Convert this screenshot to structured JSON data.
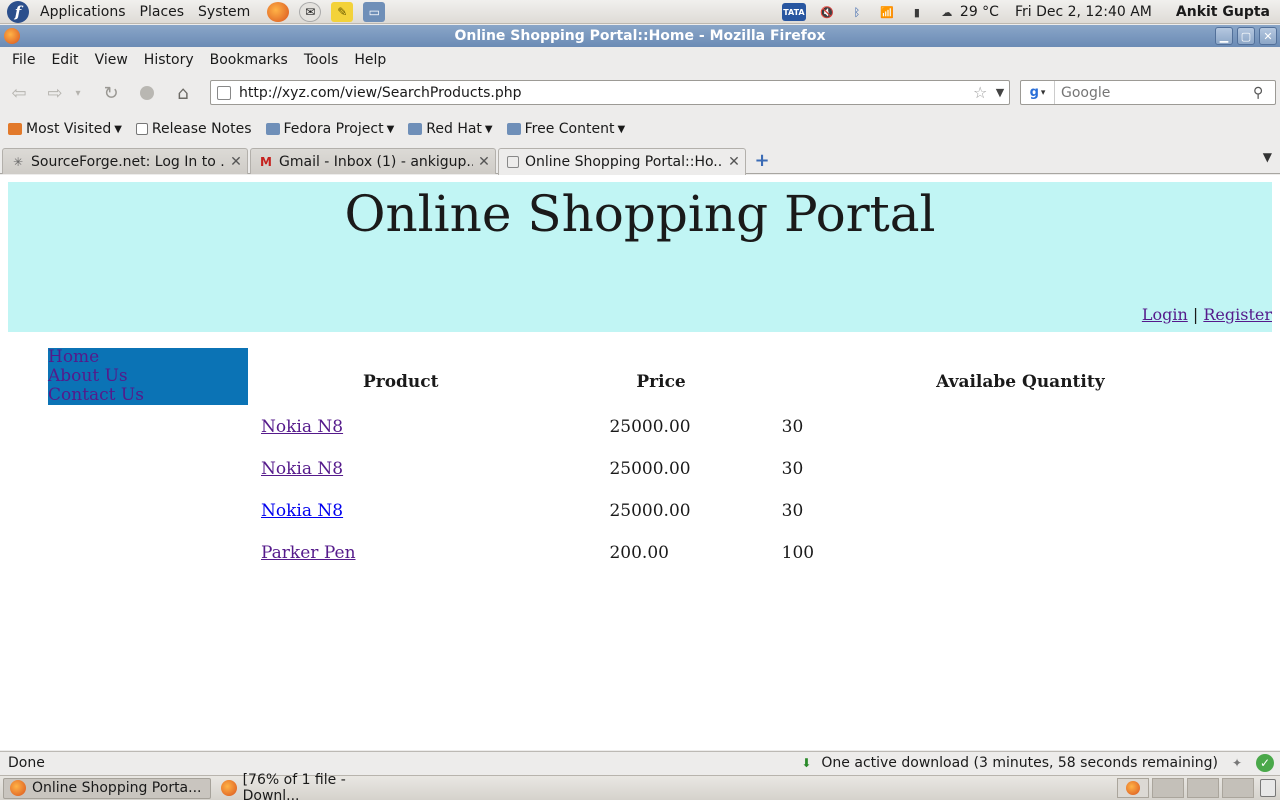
{
  "gnome_panel": {
    "menus": [
      "Applications",
      "Places",
      "System"
    ],
    "tray_label": "TATA",
    "weather": "29 °C",
    "clock": "Fri Dec  2, 12:40 AM",
    "user": "Ankit Gupta"
  },
  "window": {
    "title": "Online Shopping Portal::Home - Mozilla Firefox"
  },
  "menubar": {
    "items": [
      "File",
      "Edit",
      "View",
      "History",
      "Bookmarks",
      "Tools",
      "Help"
    ]
  },
  "navbar": {
    "url": "http://xyz.com/view/SearchProducts.php",
    "search_placeholder": "Google",
    "search_engine": "g"
  },
  "bookmarks": {
    "items": [
      "Most Visited",
      "Release Notes",
      "Fedora Project",
      "Red Hat",
      "Free Content"
    ]
  },
  "tabs": {
    "items": [
      {
        "label": "SourceForge.net: Log In to ..."
      },
      {
        "label": "Gmail - Inbox (1) - ankigup..."
      },
      {
        "label": "Online Shopping Portal::Ho..."
      }
    ],
    "active_index": 2
  },
  "page": {
    "site_title": "Online Shopping Portal",
    "login_label": "Login",
    "auth_separator": "|",
    "register_label": "Register",
    "nav": [
      "Home",
      "About Us",
      "Contact Us"
    ],
    "table": {
      "headers": [
        "Product",
        "Price",
        "Availabe Quantity"
      ],
      "rows": [
        {
          "product": "Nokia N8",
          "price": "25000.00",
          "quantity": "30"
        },
        {
          "product": "Nokia N8",
          "price": "25000.00",
          "quantity": "30"
        },
        {
          "product": "Nokia N8",
          "price": "25000.00",
          "quantity": "30"
        },
        {
          "product": "Parker Pen",
          "price": "200.00",
          "quantity": "100"
        }
      ]
    }
  },
  "statusbar": {
    "status": "Done",
    "download": "One active download (3 minutes, 58 seconds remaining)"
  },
  "taskbar": {
    "items": [
      {
        "label": "Online Shopping Porta..."
      },
      {
        "label": "[76% of 1 file - Downl..."
      }
    ]
  },
  "colors": {
    "header_bg": "#c1f5f4",
    "sidebar_bg": "#0b73b5",
    "visited_link": "#551a8b",
    "unvisited_link": "#0000ee"
  }
}
